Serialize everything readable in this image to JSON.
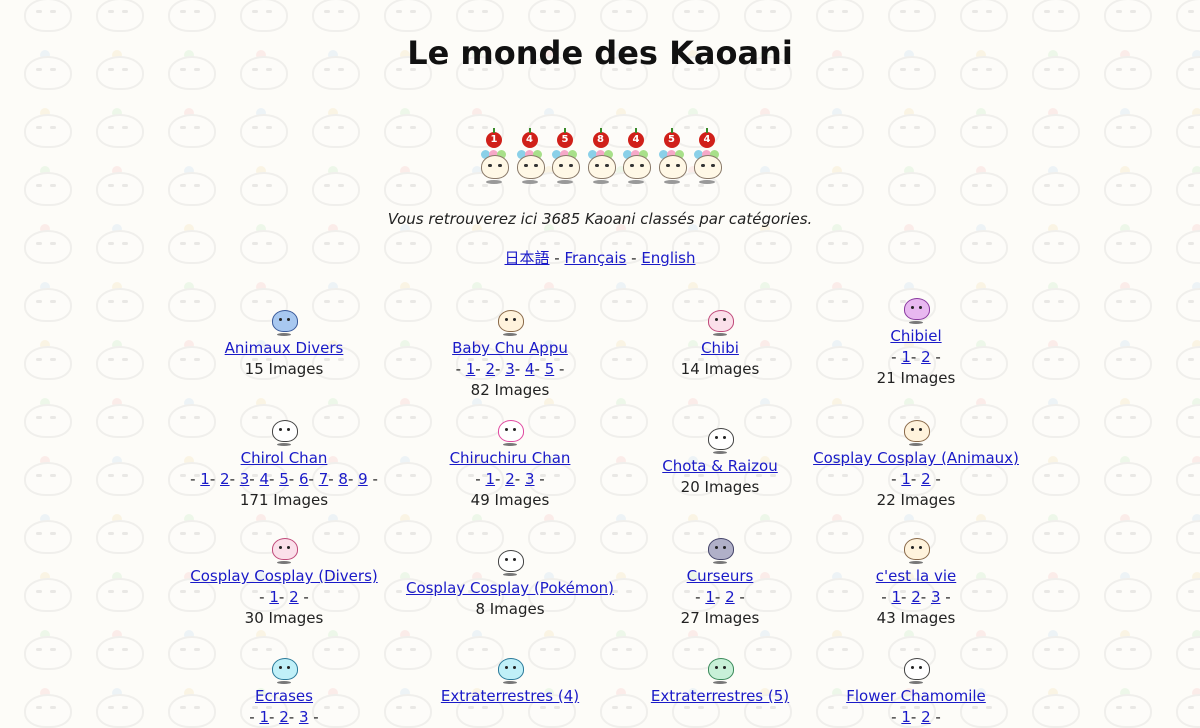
{
  "title": "Le monde des Kaoani",
  "counter_digits": [
    "1",
    "4",
    "5",
    "8",
    "4",
    "5",
    "4"
  ],
  "subtitle": "Vous retrouverez ici 3685 Kaoani classés par catégories.",
  "languages": [
    {
      "label": "日本語"
    },
    {
      "label": "Français"
    },
    {
      "label": "English"
    }
  ],
  "language_separator": "-",
  "categories": [
    {
      "name": "Animaux Divers",
      "pages": [],
      "count": "15 Images",
      "icon": "cat-kaoani-icon"
    },
    {
      "name": "Baby Chu Appu",
      "pages": [
        "1",
        "2",
        "3",
        "4",
        "5"
      ],
      "count": "82 Images",
      "icon": "baby-kaoani-icon"
    },
    {
      "name": "Chibi",
      "pages": [],
      "count": "14 Images",
      "icon": "chibi-kaoani-icon"
    },
    {
      "name": "Chibiel",
      "pages": [
        "1",
        "2"
      ],
      "count": "21 Images",
      "icon": "chibiel-kaoani-icon"
    },
    {
      "name": "Chirol Chan",
      "pages": [
        "1",
        "2",
        "3",
        "4",
        "5",
        "6",
        "7",
        "8",
        "9"
      ],
      "count": "171 Images",
      "icon": "chirol-kaoani-icon"
    },
    {
      "name": "Chiruchiru Chan",
      "pages": [
        "1",
        "2",
        "3"
      ],
      "count": "49 Images",
      "icon": "chiruchiru-kaoani-icon"
    },
    {
      "name": "Chota & Raizou",
      "pages": [],
      "count": "20 Images",
      "icon": "chota-kaoani-icon"
    },
    {
      "name": "Cosplay Cosplay (Animaux)",
      "pages": [
        "1",
        "2"
      ],
      "count": "22 Images",
      "icon": "cosplay-animal-kaoani-icon"
    },
    {
      "name": "Cosplay Cosplay (Divers)",
      "pages": [
        "1",
        "2"
      ],
      "count": "30 Images",
      "icon": "cosplay-divers-kaoani-icon"
    },
    {
      "name": "Cosplay Cosplay (Pokémon)",
      "pages": [],
      "count": "8 Images",
      "icon": "pikachu-kaoani-icon"
    },
    {
      "name": "Curseurs",
      "pages": [
        "1",
        "2"
      ],
      "count": "27 Images",
      "icon": "cursor-kaoani-icon"
    },
    {
      "name": "c'est la vie",
      "pages": [
        "1",
        "2",
        "3"
      ],
      "count": "43 Images",
      "icon": "cestlavie-kaoani-icon"
    },
    {
      "name": "Ecrases",
      "pages": [
        "1",
        "2",
        "3"
      ],
      "count": "",
      "icon": "ecrases-kaoani-icon"
    },
    {
      "name": "Extraterrestres (4)",
      "pages": [],
      "count": "",
      "icon": "alien-kaoani-icon"
    },
    {
      "name": "Extraterrestres (5)",
      "pages": [],
      "count": "",
      "icon": "alien2-kaoani-icon"
    },
    {
      "name": "Flower Chamomile",
      "pages": [
        "1",
        "2"
      ],
      "count": "",
      "icon": "sushi-kaoani-icon"
    }
  ]
}
